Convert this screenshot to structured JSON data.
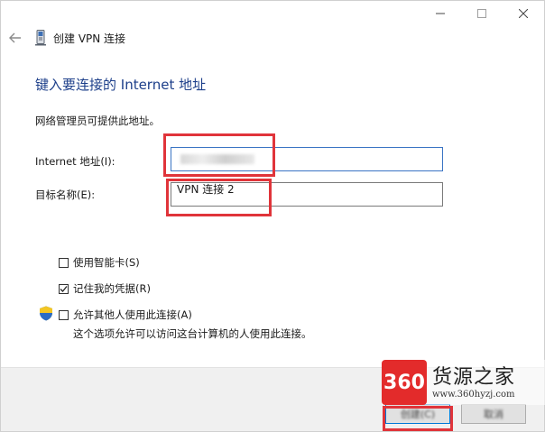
{
  "window": {
    "title": "创建 VPN 连接"
  },
  "main": {
    "heading": "键入要连接的 Internet 地址",
    "description": "网络管理员可提供此地址。",
    "internet_address_label": "Internet 地址(I):",
    "internet_address_value": "",
    "target_name_label": "目标名称(E):",
    "target_name_value": "VPN 连接 2"
  },
  "options": {
    "smart_card": {
      "label": "使用智能卡(S)",
      "checked": false
    },
    "remember_credentials": {
      "label": "记住我的凭据(R)",
      "checked": true
    },
    "allow_others": {
      "label": "允许其他人使用此连接(A)",
      "checked": false
    },
    "allow_others_note": "这个选项允许可以访问这台计算机的人使用此连接。"
  },
  "footer": {
    "create_label": "创建(C)",
    "cancel_label": "取消"
  },
  "watermark": {
    "logo": "360",
    "title": "货源之家",
    "url": "www.360hyzj.com"
  },
  "colors": {
    "heading": "#1d3f8a",
    "highlight": "#e0343a",
    "accent": "#0078d7",
    "watermark_red": "#e32b2b"
  },
  "icons": {
    "back": "back-arrow-icon",
    "app": "vpn-network-icon",
    "shield": "uac-shield-icon"
  }
}
